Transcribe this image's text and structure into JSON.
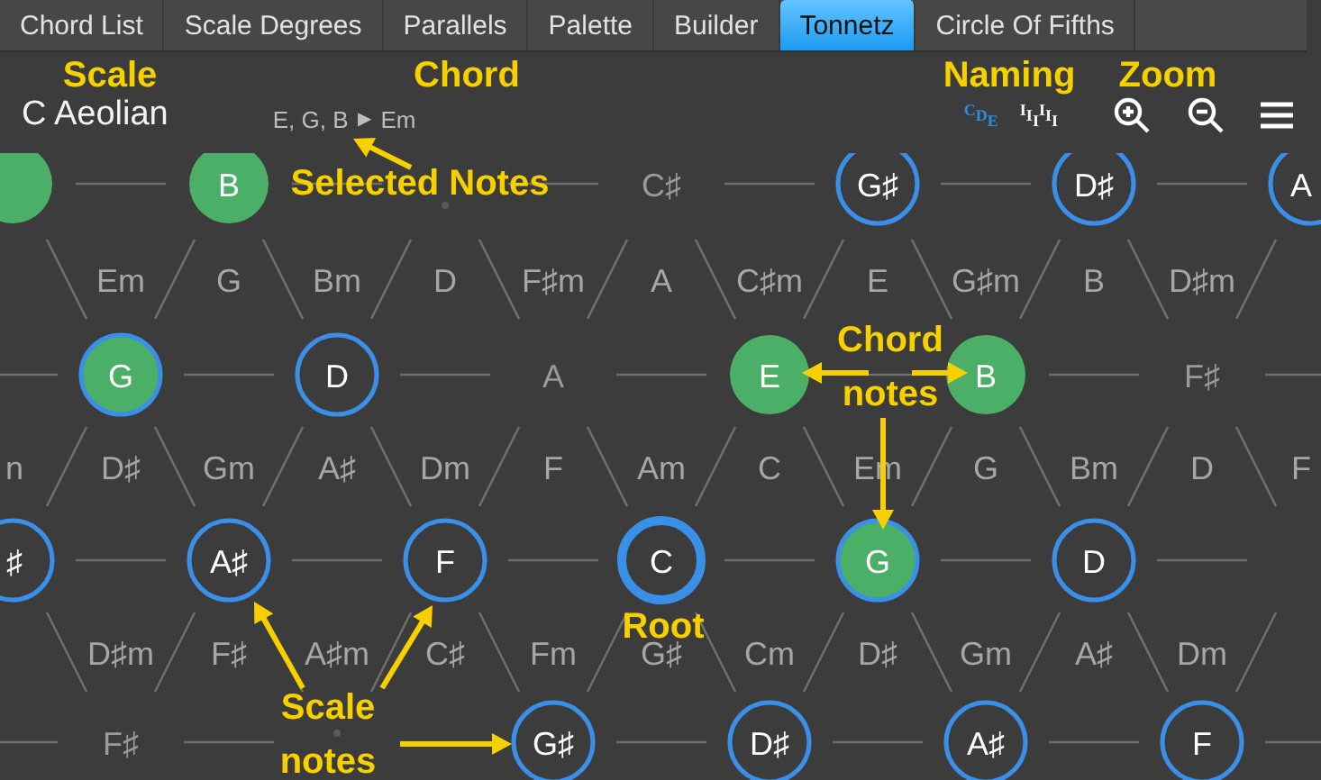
{
  "tabs": [
    {
      "label": "Chord List",
      "selected": false
    },
    {
      "label": "Scale Degrees",
      "selected": false
    },
    {
      "label": "Parallels",
      "selected": false
    },
    {
      "label": "Palette",
      "selected": false
    },
    {
      "label": "Builder",
      "selected": false
    },
    {
      "label": "Tonnetz",
      "selected": true
    },
    {
      "label": "Circle Of Fifths",
      "selected": false
    }
  ],
  "header": {
    "scale": "C Aeolian",
    "chord_notes": "E, G, B",
    "chord_arrow": "▶",
    "chord": "Em",
    "naming_modes": [
      {
        "label": "CDE",
        "selected": true
      },
      {
        "label": "IIIIII",
        "selected": false
      }
    ]
  },
  "tonnetz": {
    "note_rows": [
      {
        "notes": [
          {
            "in_scale": false,
            "selected": true,
            "root": false
          },
          {
            "label": "B",
            "in_scale": false,
            "selected": true,
            "root": false
          },
          {
            "kind": "covered"
          },
          {
            "label": "C♯",
            "in_scale": false,
            "selected": false,
            "root": false
          },
          {
            "label": "G♯",
            "in_scale": true,
            "selected": false,
            "root": false
          },
          {
            "label": "D♯",
            "in_scale": true,
            "selected": false,
            "root": false
          },
          {
            "label": "A",
            "in_scale": true,
            "selected": false,
            "root": false
          }
        ]
      },
      {
        "notes": [
          {
            "label": "G",
            "in_scale": true,
            "selected": true,
            "root": false
          },
          {
            "label": "D",
            "in_scale": true,
            "selected": false,
            "root": false
          },
          {
            "label": "A",
            "in_scale": false,
            "selected": false,
            "root": false
          },
          {
            "label": "E",
            "in_scale": false,
            "selected": true,
            "root": false
          },
          {
            "label": "B",
            "in_scale": false,
            "selected": true,
            "root": false
          },
          {
            "label": "F♯",
            "in_scale": false,
            "selected": false,
            "root": false
          }
        ]
      },
      {
        "notes": [
          {
            "label": "♯",
            "in_scale": true,
            "selected": false,
            "root": false
          },
          {
            "label": "A♯",
            "in_scale": true,
            "selected": false,
            "root": false
          },
          {
            "label": "F",
            "in_scale": true,
            "selected": false,
            "root": false
          },
          {
            "label": "C",
            "in_scale": true,
            "selected": false,
            "root": true
          },
          {
            "label": "G",
            "in_scale": true,
            "selected": true,
            "root": false
          },
          {
            "label": "D",
            "in_scale": true,
            "selected": false,
            "root": false
          }
        ]
      },
      {
        "notes": [
          {
            "label": "F♯",
            "in_scale": false,
            "selected": false,
            "root": false
          },
          {
            "kind": "covered"
          },
          {
            "label": "G♯",
            "in_scale": true,
            "selected": false,
            "root": false
          },
          {
            "label": "D♯",
            "in_scale": true,
            "selected": false,
            "root": false
          },
          {
            "label": "A♯",
            "in_scale": true,
            "selected": false,
            "root": false
          },
          {
            "label": "F",
            "in_scale": true,
            "selected": false,
            "root": false
          }
        ]
      }
    ],
    "chord_rows": [
      {
        "chords": [
          "Em",
          "G",
          "Bm",
          "D",
          "F♯m",
          "A",
          "C♯m",
          "E",
          "G♯m",
          "B",
          "D♯m"
        ]
      },
      {
        "chords": [
          "n",
          "D♯",
          "Gm",
          "A♯",
          "Dm",
          "F",
          "Am",
          "C",
          "Em",
          "G",
          "Bm",
          "D",
          "F"
        ]
      },
      {
        "chords": [
          "D♯m",
          "F♯",
          "A♯m",
          "C♯",
          "Fm",
          "G♯",
          "Cm",
          "D♯",
          "Gm",
          "A♯",
          "Dm"
        ]
      }
    ]
  },
  "annotations": [
    {
      "text": "Scale"
    },
    {
      "text": "Chord"
    },
    {
      "text": "Naming"
    },
    {
      "text": "Zoom"
    },
    {
      "text": "Selected Notes"
    },
    {
      "text": "Chord"
    },
    {
      "text": "notes"
    },
    {
      "text": "Root"
    },
    {
      "text": "Scale"
    },
    {
      "text": "notes"
    }
  ]
}
